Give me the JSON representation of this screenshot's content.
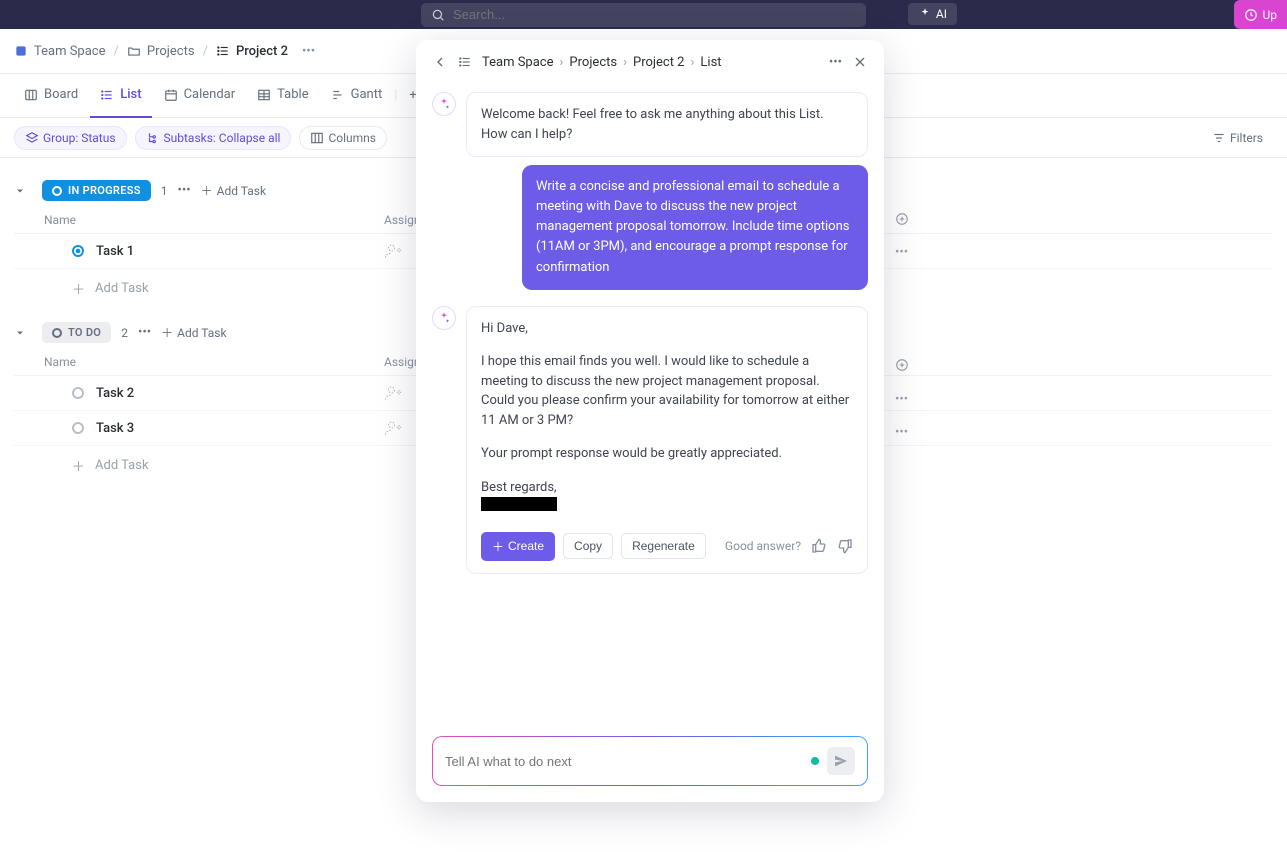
{
  "search": {
    "placeholder": "Search..."
  },
  "ai_label": "AI",
  "upgrade_label": "Up",
  "breadcrumbs": [
    {
      "label": "Team Space"
    },
    {
      "label": "Projects"
    },
    {
      "label": "Project 2"
    }
  ],
  "views": {
    "board": "Board",
    "list": "List",
    "calendar": "Calendar",
    "table": "Table",
    "gantt": "Gantt",
    "add": "+  V"
  },
  "toolbar": {
    "group": "Group: Status",
    "subtasks": "Subtasks: Collapse all",
    "columns": "Columns",
    "filters": "Filters"
  },
  "groups": [
    {
      "name": "IN PROGRESS",
      "count": "1",
      "add": "Add Task",
      "cols": {
        "name": "Name",
        "assignee": "Assigne"
      },
      "tasks": [
        {
          "name": "Task 1"
        }
      ],
      "add_inline": "Add Task"
    },
    {
      "name": "TO DO",
      "count": "2",
      "add": "Add Task",
      "cols": {
        "name": "Name",
        "assignee": "Assigne"
      },
      "tasks": [
        {
          "name": "Task 2"
        },
        {
          "name": "Task 3"
        }
      ],
      "add_inline": "Add Task"
    }
  ],
  "panel": {
    "crumbs": [
      "Team Space",
      "Projects",
      "Project 2",
      "List"
    ],
    "messages": {
      "welcome": "Welcome back! Feel free to ask me anything about this List. How can I help?",
      "user": "Write a concise and professional email to schedule a meeting with Dave to discuss the new project management proposal tomorrow. Include time options (11AM or 3PM), and encourage a prompt response for confirmation",
      "reply": {
        "p1": "Hi Dave,",
        "p2": "I hope this email finds you well. I would like to schedule a meeting to discuss the new project management proposal. Could you please confirm your availability for tomorrow at either 11 AM or 3 PM?",
        "p3": "Your prompt response would be greatly appreciated.",
        "p4": "Best regards,"
      }
    },
    "actions": {
      "create": "Create",
      "copy": "Copy",
      "regenerate": "Regenerate",
      "good": "Good answer?"
    },
    "input_placeholder": "Tell AI what to do next"
  }
}
